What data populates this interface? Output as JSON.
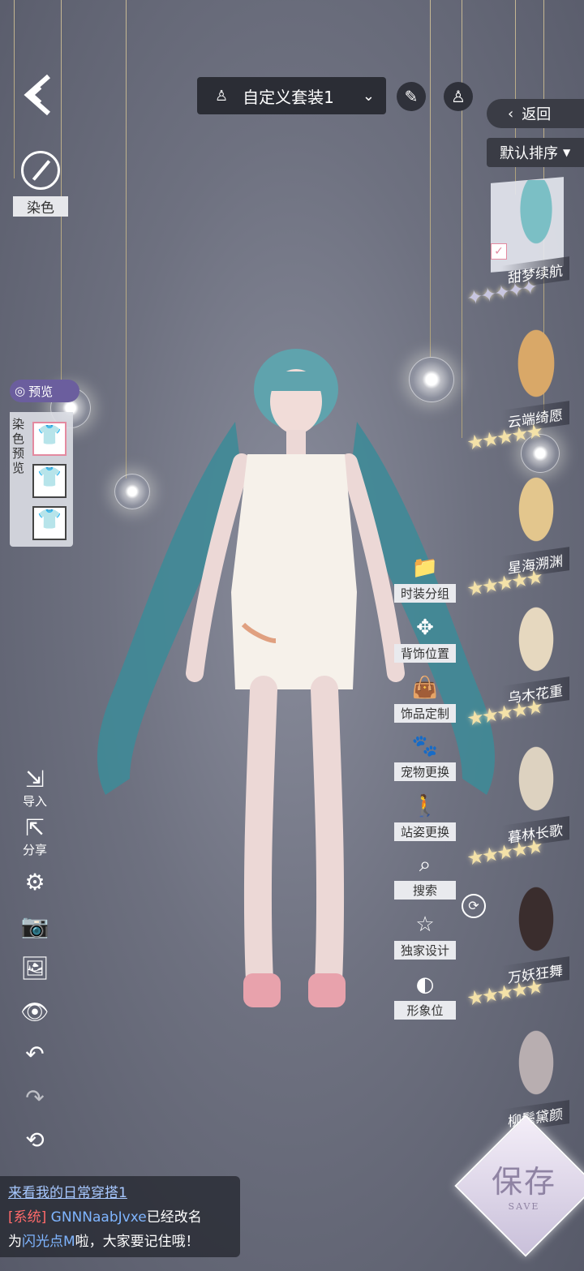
{
  "header": {
    "outfit_name": "自定义套装1",
    "outfit_icon": "dress-icon",
    "dropdown_icon": "chevron-down-icon",
    "brush_icon": "brush-icon",
    "outfit_button_icon": "dress-icon"
  },
  "left_top": {
    "back_icon": "back-arrow-icon",
    "dye_label": "染色"
  },
  "dye_preview": {
    "preview_label": "预览",
    "title": "染色预览"
  },
  "right_panel": {
    "back_label": "返回",
    "sort_label": "默认排序",
    "items": [
      {
        "name": "甜梦续航",
        "stars": "✦✦✦✦✦"
      },
      {
        "name": "云端绮愿",
        "stars": "★★★★★"
      },
      {
        "name": "星海溯渊",
        "stars": "★★★★★"
      },
      {
        "name": "乌木花重",
        "stars": "★★★★★"
      },
      {
        "name": "暮林长歌",
        "stars": "★★★★★"
      },
      {
        "name": "万妖狂舞",
        "stars": "★★★★★"
      },
      {
        "name": "柳鬓黛颜",
        "stars": ""
      }
    ]
  },
  "actions": {
    "outfit_group": "时装分组",
    "back_accessory": "背饰位置",
    "accessory_custom": "饰品定制",
    "pet_change": "宠物更换",
    "pose_change": "站姿更换",
    "search": "搜索",
    "exclusive_design": "独家设计",
    "image_slot": "形象位"
  },
  "left_tools": {
    "import": "导入",
    "share": "分享"
  },
  "chat": {
    "line1": "来看我的日常穿搭1",
    "sys_tag": "[系统]",
    "old_name": "GNNNaabJvxe",
    "renamed": "已经改名",
    "prefix": "为",
    "new_name": "闪光点M",
    "suffix": "啦，大家要记住哦！"
  },
  "save": {
    "label": "保存",
    "sub": "SAVE"
  }
}
